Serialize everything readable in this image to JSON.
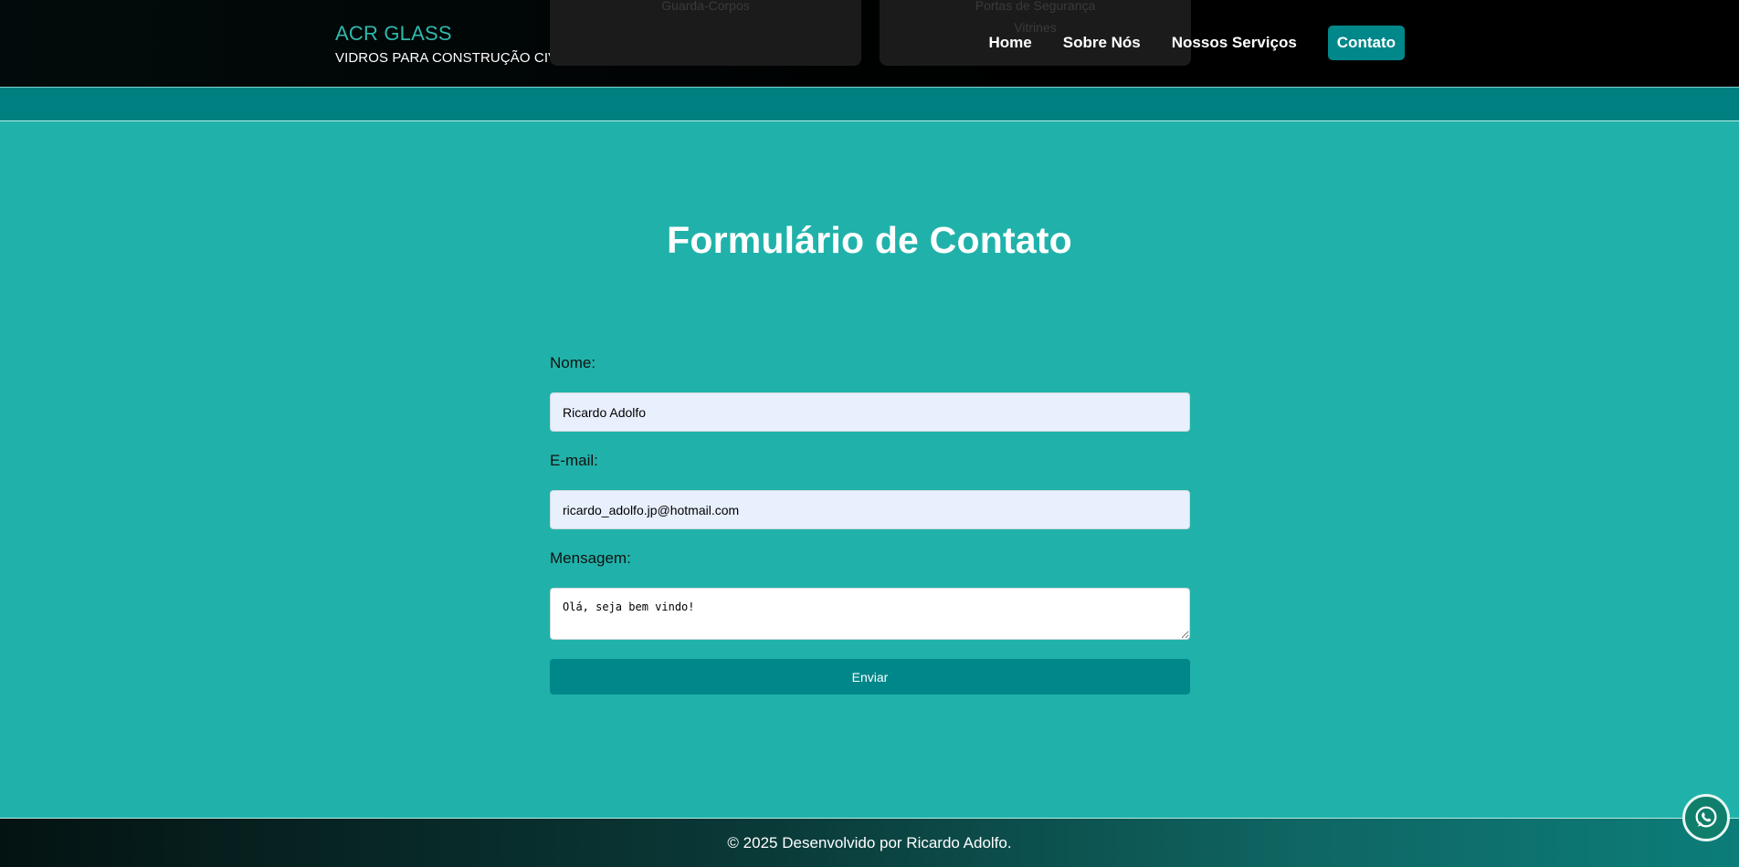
{
  "brand": {
    "title": "ACR GLASS",
    "subtitle": "VIDROS PARA CONSTRUÇÃO CIVIL"
  },
  "ghost_cards": [
    {
      "line1": "Guarda-Corpos",
      "line2": ""
    },
    {
      "line1": "Portas de Segurança",
      "line2": "Vitrines"
    }
  ],
  "nav": {
    "items": [
      {
        "label": "Home"
      },
      {
        "label": "Sobre Nós"
      },
      {
        "label": "Nossos Serviços"
      },
      {
        "label": "Contato"
      }
    ],
    "active": "Contato"
  },
  "form": {
    "title": "Formulário de Contato",
    "name_label": "Nome:",
    "name_value": "Ricardo Adolfo",
    "email_label": "E-mail:",
    "email_value": "ricardo_adolfo.jp@hotmail.com",
    "message_label": "Mensagem:",
    "message_value": "Olá, seja bem vindo!",
    "submit_label": "Enviar"
  },
  "footer": {
    "text": "© 2025 Desenvolvido por Ricardo Adolfo."
  },
  "floating": {
    "icon": "whatsapp-icon"
  },
  "colors": {
    "accent": "#20b2aa",
    "button": "#00878a",
    "band": "#008080",
    "brand_title": "#2fb9ad"
  }
}
